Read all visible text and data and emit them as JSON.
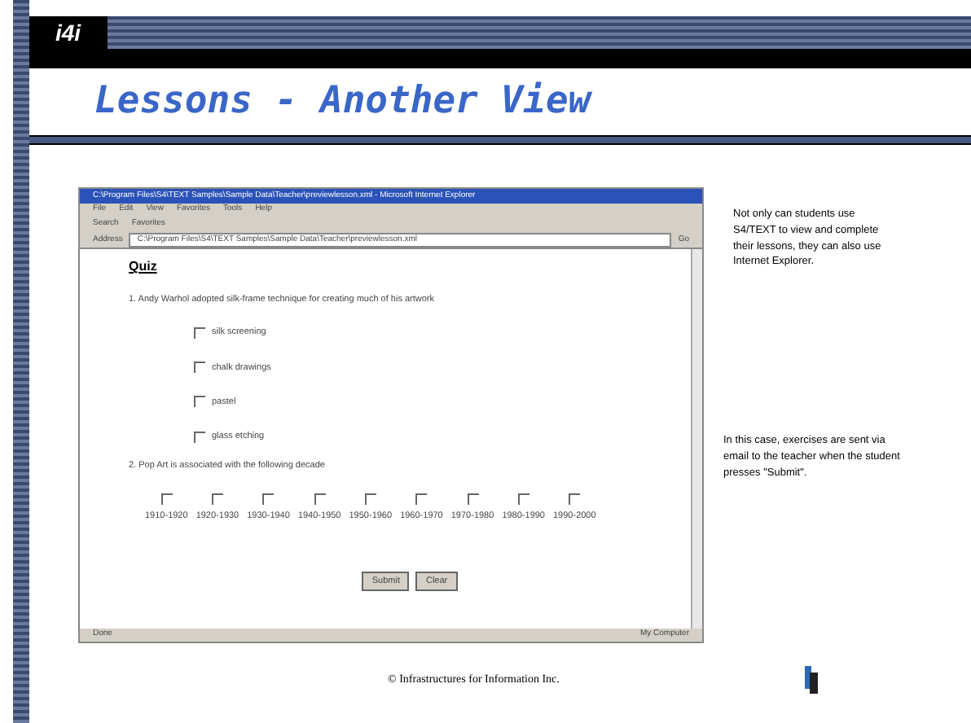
{
  "logo": "i4i",
  "title": "Lessons - Another View",
  "browser": {
    "title": "C:\\Program Files\\S4\\TEXT Samples\\Sample Data\\Teacher\\previewlesson.xml - Microsoft Internet Explorer",
    "menu": [
      "File",
      "Edit",
      "View",
      "Favorites",
      "Tools",
      "Help"
    ],
    "toolbar": [
      "Search",
      "Favorites"
    ],
    "address_label": "Address",
    "address": "C:\\Program Files\\S4\\TEXT Samples\\Sample Data\\Teacher\\previewlesson.xml",
    "go": "Go",
    "heading": "Quiz",
    "questions": [
      {
        "text": "1. Andy Warhol adopted silk-frame technique for creating much of his artwork",
        "kind": "column",
        "options": [
          {
            "label": "silk screening",
            "checked": false
          },
          {
            "label": "chalk drawings",
            "checked": false
          },
          {
            "label": "pastel",
            "checked": false
          },
          {
            "label": "glass etching",
            "checked": false
          }
        ]
      },
      {
        "text": "2. Pop Art is associated with the following decade",
        "kind": "row",
        "options": [
          {
            "label": "1910-1920",
            "checked": false
          },
          {
            "label": "1920-1930",
            "checked": false
          },
          {
            "label": "1930-1940",
            "checked": false
          },
          {
            "label": "1940-1950",
            "checked": false
          },
          {
            "label": "1950-1960",
            "checked": false
          },
          {
            "label": "1960-1970",
            "checked": false
          },
          {
            "label": "1970-1980",
            "checked": false
          },
          {
            "label": "1980-1990",
            "checked": false
          },
          {
            "label": "1990-2000",
            "checked": false
          }
        ]
      }
    ],
    "buttons": [
      "Submit",
      "Clear"
    ],
    "status": "Done",
    "zone": "My Computer"
  },
  "notes": [
    "Not only can students use S4/TEXT to view and complete their lessons, they can also use Internet Explorer.",
    "In this case, exercises are sent via email to the teacher when the student presses \"Submit\"."
  ],
  "footer": "© Infrastructures for Information Inc."
}
